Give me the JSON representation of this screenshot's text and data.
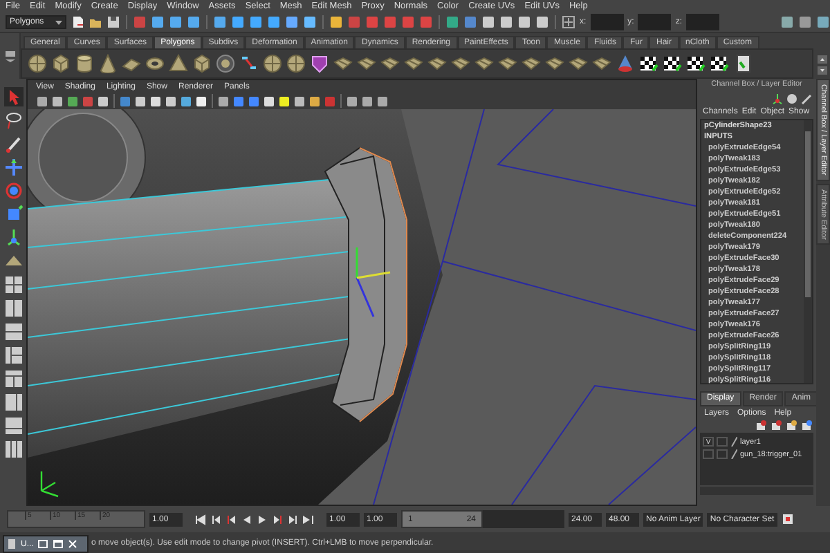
{
  "menu_bar": [
    "File",
    "Edit",
    "Modify",
    "Create",
    "Display",
    "Window",
    "Assets",
    "Select",
    "Mesh",
    "Edit Mesh",
    "Proxy",
    "Normals",
    "Color",
    "Create UVs",
    "Edit UVs",
    "Help"
  ],
  "status_line": {
    "mode_dropdown": "Polygons",
    "coordinate_labels": [
      "x:",
      "y:",
      "z:"
    ]
  },
  "shelf": {
    "tabs": [
      {
        "label": "General",
        "selected": false
      },
      {
        "label": "Curves",
        "selected": false
      },
      {
        "label": "Surfaces",
        "selected": false
      },
      {
        "label": "Polygons",
        "selected": true
      },
      {
        "label": "Subdivs",
        "selected": false
      },
      {
        "label": "Deformation",
        "selected": false
      },
      {
        "label": "Animation",
        "selected": false
      },
      {
        "label": "Dynamics",
        "selected": false
      },
      {
        "label": "Rendering",
        "selected": false
      },
      {
        "label": "PaintEffects",
        "selected": false
      },
      {
        "label": "Toon",
        "selected": false
      },
      {
        "label": "Muscle",
        "selected": false
      },
      {
        "label": "Fluids",
        "selected": false
      },
      {
        "label": "Fur",
        "selected": false
      },
      {
        "label": "Hair",
        "selected": false
      },
      {
        "label": "nCloth",
        "selected": false
      },
      {
        "label": "Custom",
        "selected": false
      }
    ]
  },
  "viewport": {
    "menu": [
      "View",
      "Shading",
      "Lighting",
      "Show",
      "Renderer",
      "Panels"
    ]
  },
  "channel_box": {
    "title": "Channel Box / Layer Editor",
    "menu": [
      "Channels",
      "Edit",
      "Object",
      "Show"
    ],
    "shape": "pCylinderShape23",
    "section": "INPUTS",
    "inputs": [
      "polyExtrudeEdge54",
      "polyTweak183",
      "polyExtrudeEdge53",
      "polyTweak182",
      "polyExtrudeEdge52",
      "polyTweak181",
      "polyExtrudeEdge51",
      "polyTweak180",
      "deleteComponent224",
      "polyTweak179",
      "polyExtrudeFace30",
      "polyTweak178",
      "polyExtrudeFace29",
      "polyExtrudeFace28",
      "polyTweak177",
      "polyExtrudeFace27",
      "polyTweak176",
      "polyExtrudeFace26",
      "polySplitRing119",
      "polySplitRing118",
      "polySplitRing117",
      "polySplitRing116"
    ]
  },
  "layer_editor": {
    "tabs": [
      {
        "label": "Display",
        "selected": true
      },
      {
        "label": "Render",
        "selected": false
      },
      {
        "label": "Anim",
        "selected": false
      }
    ],
    "menu": [
      "Layers",
      "Options",
      "Help"
    ],
    "layers": [
      {
        "name": "layer1",
        "visibility": "V"
      },
      {
        "name": "gun_18:trigger_01"
      }
    ]
  },
  "side_tabs": [
    {
      "label": "Channel Box / Layer Editor",
      "selected": true
    },
    {
      "label": "Attribute Editor",
      "selected": false
    }
  ],
  "time_slider": {
    "ticks": [
      "5",
      "10",
      "15",
      "20"
    ],
    "current_time": "1.00"
  },
  "range_slider": {
    "start_time": "1.00",
    "range_start": "1.00",
    "level": 0.5,
    "range_min": "1",
    "range_max": "24",
    "range_end": "24.00",
    "end_time": "48.00",
    "anim_layer": "No Anim Layer",
    "character_set": "No Character Set"
  },
  "minimized_window": {
    "title": "U..."
  },
  "help_line": "o move object(s). Use edit mode to change pivot (INSERT).  Ctrl+LMB to move perpendicular."
}
